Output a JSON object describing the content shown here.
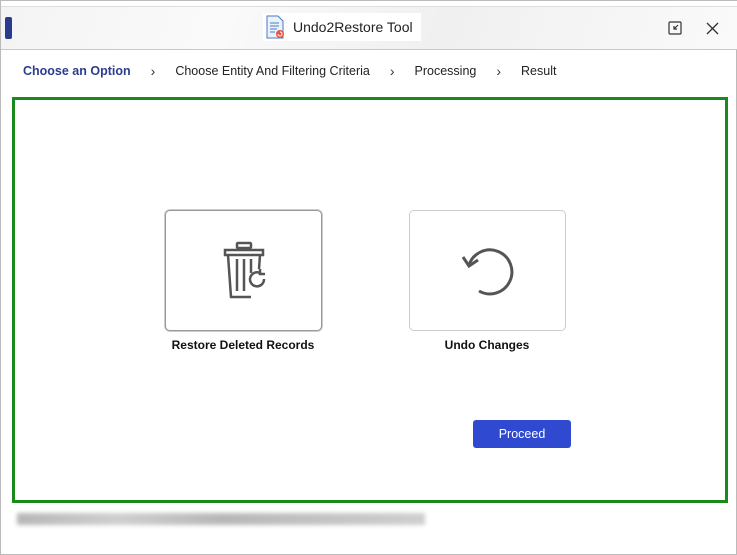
{
  "window": {
    "title": "Undo2Restore Tool",
    "icons": {
      "app": "document-restore-icon",
      "restore_down": "restore-window-icon",
      "close": "close-icon"
    }
  },
  "steps": [
    {
      "label": "Choose an Option",
      "active": true
    },
    {
      "label": "Choose Entity And Filtering Criteria",
      "active": false
    },
    {
      "label": "Processing",
      "active": false
    },
    {
      "label": "Result",
      "active": false
    }
  ],
  "options": [
    {
      "label": "Restore Deleted Records",
      "icon": "trash-restore-icon",
      "selected": true
    },
    {
      "label": "Undo Changes",
      "icon": "undo-icon",
      "selected": false
    }
  ],
  "proceed_label": "Proceed",
  "colors": {
    "accent": "#2f4ad0",
    "active_step": "#2b3d8f",
    "content_border": "#1a8a1a"
  }
}
